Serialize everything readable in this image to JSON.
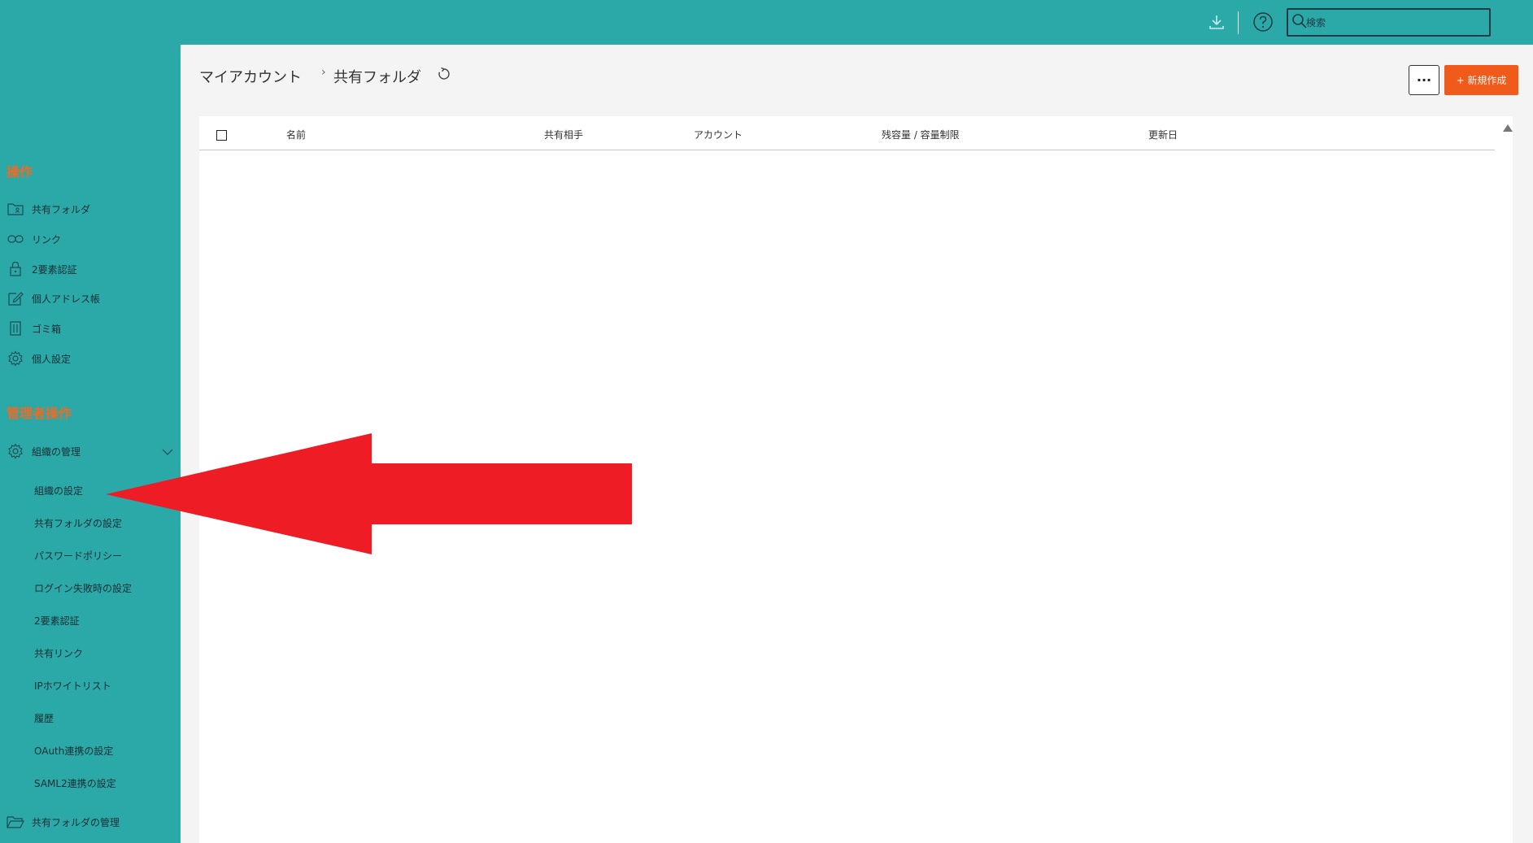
{
  "topbar": {
    "download_icon": "download-icon",
    "help_icon": "help-icon",
    "search_placeholder": "検索"
  },
  "sidebar": {
    "section_ops": "操作",
    "items": [
      {
        "label": "共有フォルダ",
        "icon": "shared-folder-icon"
      },
      {
        "label": "リンク",
        "icon": "link-icon"
      },
      {
        "label": "2要素認証",
        "icon": "lock-icon"
      },
      {
        "label": "個人アドレス帳",
        "icon": "edit-icon"
      },
      {
        "label": "ゴミ箱",
        "icon": "trash-icon"
      },
      {
        "label": "個人設定",
        "icon": "gear-icon"
      }
    ],
    "section_admin": "管理者操作",
    "org_manage": {
      "label": "組織の管理",
      "icon": "gear-icon"
    },
    "sub_items": [
      "組織の設定",
      "共有フォルダの設定",
      "パスワードポリシー",
      "ログイン失敗時の設定",
      "2要素認証",
      "共有リンク",
      "IPホワイトリスト",
      "履歴",
      "OAuth連携の設定",
      "SAML2連携の設定"
    ],
    "shared_folder_manage": {
      "label": "共有フォルダの管理",
      "icon": "folder-icon"
    }
  },
  "main": {
    "breadcrumb": [
      "マイアカウント",
      "共有フォルダ"
    ],
    "more_label": "···",
    "new_label": "+ 新規作成",
    "columns": [
      "名前",
      "共有相手",
      "アカウント",
      "残容量 / 容量制限",
      "更新日"
    ]
  },
  "colors": {
    "sidebar_bg": "#2aa9a8",
    "accent_orange": "#f26a21",
    "button_orange": "#f05a1a",
    "annotation_red": "#ee1c25"
  }
}
